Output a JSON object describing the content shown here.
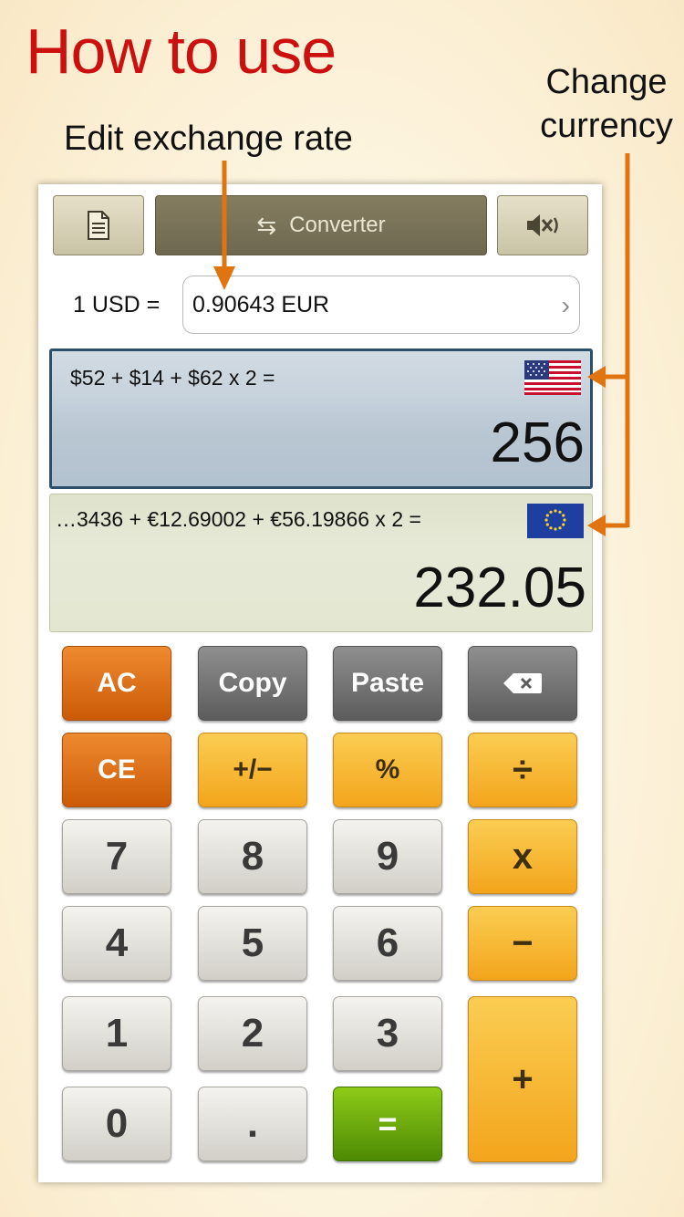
{
  "headline": "How to use",
  "annotations": {
    "edit_rate": "Edit exchange rate",
    "change_currency_line1": "Change",
    "change_currency_line2": "currency"
  },
  "toolbar": {
    "doc_icon": "document-icon",
    "converter_label": "Converter",
    "swap_icon": "swap-arrows-icon",
    "mute_icon": "speaker-mute-icon"
  },
  "rate": {
    "label": "1 USD =",
    "value": "0.90643 EUR"
  },
  "usd_panel": {
    "expression": "$52 + $14 + $62 x 2 =",
    "result": "256",
    "flag": "us-flag-icon"
  },
  "eur_panel": {
    "expression": "…3436 + €12.69002 + €56.19866 x 2 =",
    "result": "232.05",
    "flag": "eu-flag-icon"
  },
  "keys": {
    "ac": "AC",
    "copy": "Copy",
    "paste": "Paste",
    "ce": "CE",
    "sign": "+/−",
    "percent": "%",
    "divide": "÷",
    "seven": "7",
    "eight": "8",
    "nine": "9",
    "multiply": "x",
    "four": "4",
    "five": "5",
    "six": "6",
    "minus": "−",
    "one": "1",
    "two": "2",
    "three": "3",
    "plus": "+",
    "zero": "0",
    "dot": ".",
    "equals": "="
  },
  "colors": {
    "headline": "#cc0f0f",
    "arrow": "#e07410",
    "usd_border": "#2d4f6a"
  }
}
